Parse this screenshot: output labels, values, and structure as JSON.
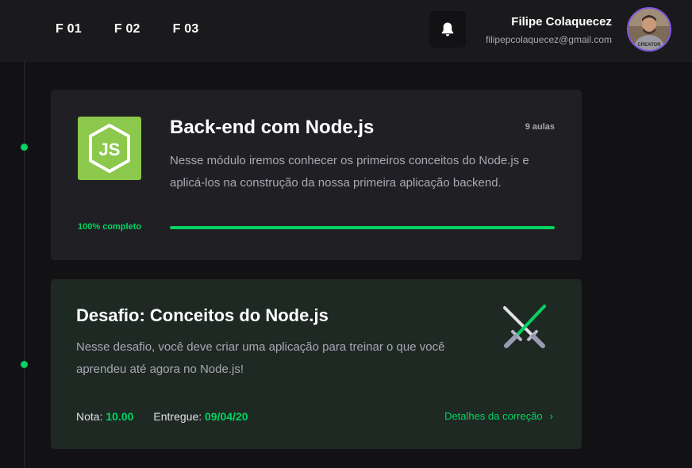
{
  "header": {
    "tabs": [
      {
        "label": "F 01"
      },
      {
        "label": "F 02"
      },
      {
        "label": "F 03"
      }
    ],
    "notification_icon": "bell-icon",
    "user": {
      "name": "Filipe Colaquecez",
      "email": "filipepcolaquecez@gmail.com",
      "avatar_shirt_text": "CREATOR"
    }
  },
  "module": {
    "title": "Back-end com Node.js",
    "lessons": "9 aulas",
    "description": "Nesse módulo iremos conhecer os primeiros conceitos do Node.js e aplicá-los na construção da nossa primeira aplicação backend.",
    "logo_text": "JS",
    "progress_label": "100% completo",
    "progress_percent": 100
  },
  "challenge": {
    "title": "Desafio: Conceitos do Node.js",
    "description": "Nesse desafio, você deve criar uma aplicação para treinar o que você aprendeu até agora no Node.js!",
    "grade_label": "Nota:",
    "grade_value": "10.00",
    "delivered_label": "Entregue:",
    "delivered_value": "09/04/20",
    "details_link": "Detalhes da correção",
    "details_icon": "chevron-right-icon"
  },
  "colors": {
    "accent": "#04d361",
    "background": "#121214",
    "header": "#1a1a1d",
    "card": "#202024",
    "challenge_card": "#1e2924",
    "node_green": "#8cc84b"
  }
}
